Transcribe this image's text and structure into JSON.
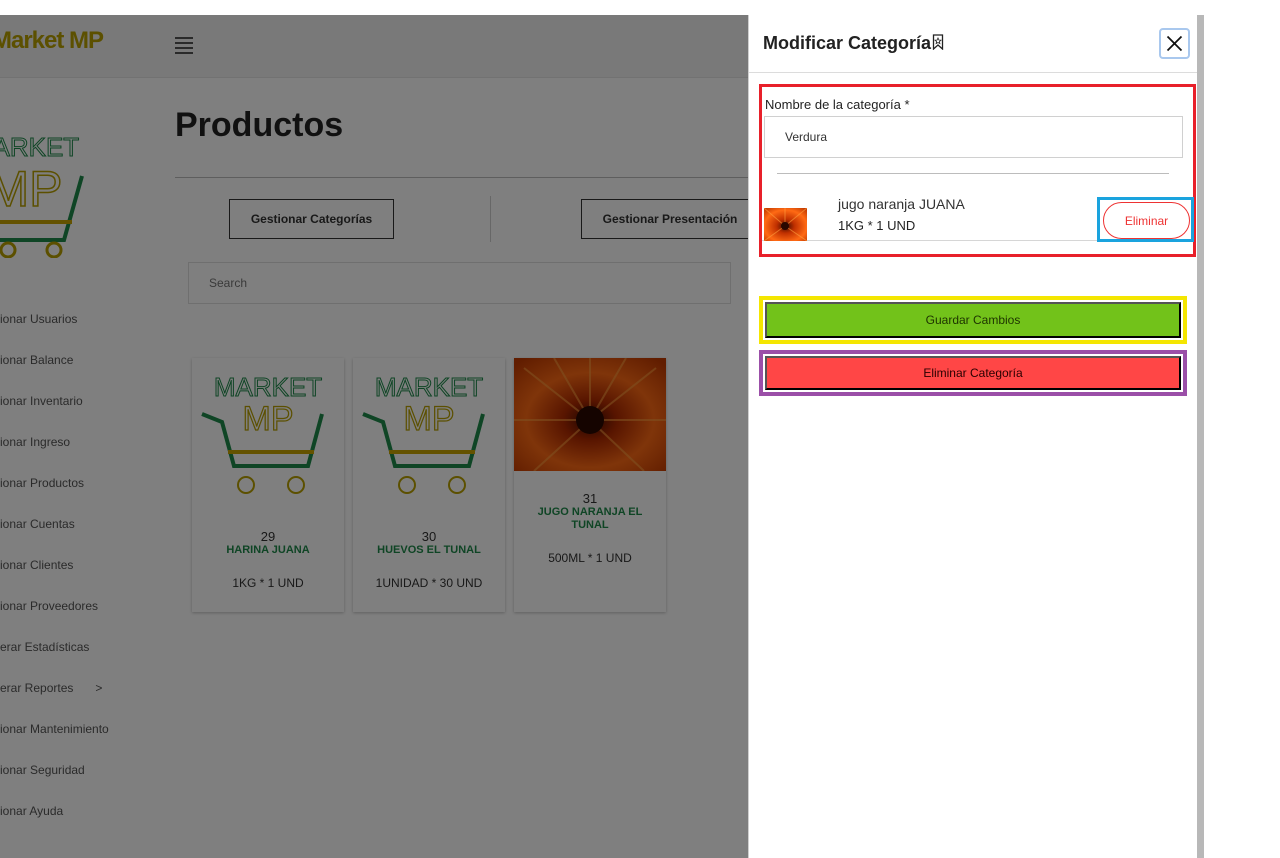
{
  "app": {
    "brand": "Market MP",
    "page_title": "Productos",
    "buttons": {
      "categories": "Gestionar Categorías",
      "presentation": "Gestionar Presentación"
    },
    "search": {
      "placeholder": "Search"
    },
    "sidebar": {
      "items": [
        {
          "label": "ionar Usuarios"
        },
        {
          "label": "ionar Balance"
        },
        {
          "label": "ionar Inventario"
        },
        {
          "label": "ionar Ingreso"
        },
        {
          "label": "ionar Productos"
        },
        {
          "label": "ionar Cuentas"
        },
        {
          "label": "ionar Clientes"
        },
        {
          "label": "ionar Proveedores"
        },
        {
          "label": "erar Estadísticas"
        },
        {
          "label": "erar Reportes",
          "chevron": ">"
        },
        {
          "label": "ionar Mantenimiento"
        },
        {
          "label": "ionar Seguridad"
        },
        {
          "label": "ionar Ayuda"
        }
      ]
    },
    "products": [
      {
        "id": "29",
        "name": "HARINA JUANA",
        "qty": "1KG * 1 UND",
        "image": "market-mp-logo"
      },
      {
        "id": "30",
        "name": "HUEVOS EL TUNAL",
        "qty": "1UNIDAD * 30 UND",
        "image": "market-mp-logo"
      },
      {
        "id": "31",
        "name": "JUGO NARANJA EL TUNAL",
        "qty": "500ML * 1 UND",
        "image": "orange-flower-photo"
      }
    ]
  },
  "modal": {
    "title": "Modificar Categoría",
    "close_symbol": "✕",
    "field_label": "Nombre de la categoría *",
    "field_value": "Verdura",
    "items": [
      {
        "name": "jugo naranja JUANA",
        "qty": "1KG * 1 UND",
        "remove_label": "Eliminar"
      }
    ],
    "save_label": "Guardar Cambios",
    "delete_label": "Eliminar Categoría"
  },
  "colors": {
    "save": "#72c21a",
    "delete": "#ff4646",
    "highlight_red": "#e8202a",
    "highlight_blue": "#1aa3de",
    "highlight_yellow": "#f4e600",
    "highlight_purple": "#9b4fa8",
    "brand": "#b8a000",
    "product_name": "#1e8a4a"
  }
}
